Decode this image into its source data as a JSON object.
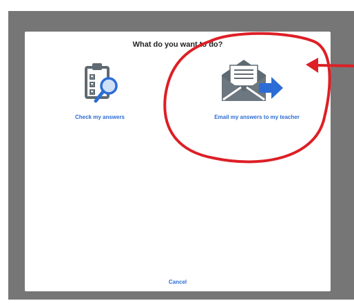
{
  "dialog": {
    "title": "What do you want to do?",
    "options": [
      {
        "label": "Check my answers",
        "icon": "clipboard-magnifier-icon"
      },
      {
        "label": "Email my answers to my teacher",
        "icon": "envelope-arrow-icon"
      }
    ],
    "cancel_label": "Cancel"
  },
  "colors": {
    "accent": "#2b6cd6",
    "icon_gray": "#5f6a72",
    "overlay": "#767676",
    "annotation_red": "#dd1f26"
  },
  "annotation": {
    "highlighted_option": "email-answers-option"
  }
}
